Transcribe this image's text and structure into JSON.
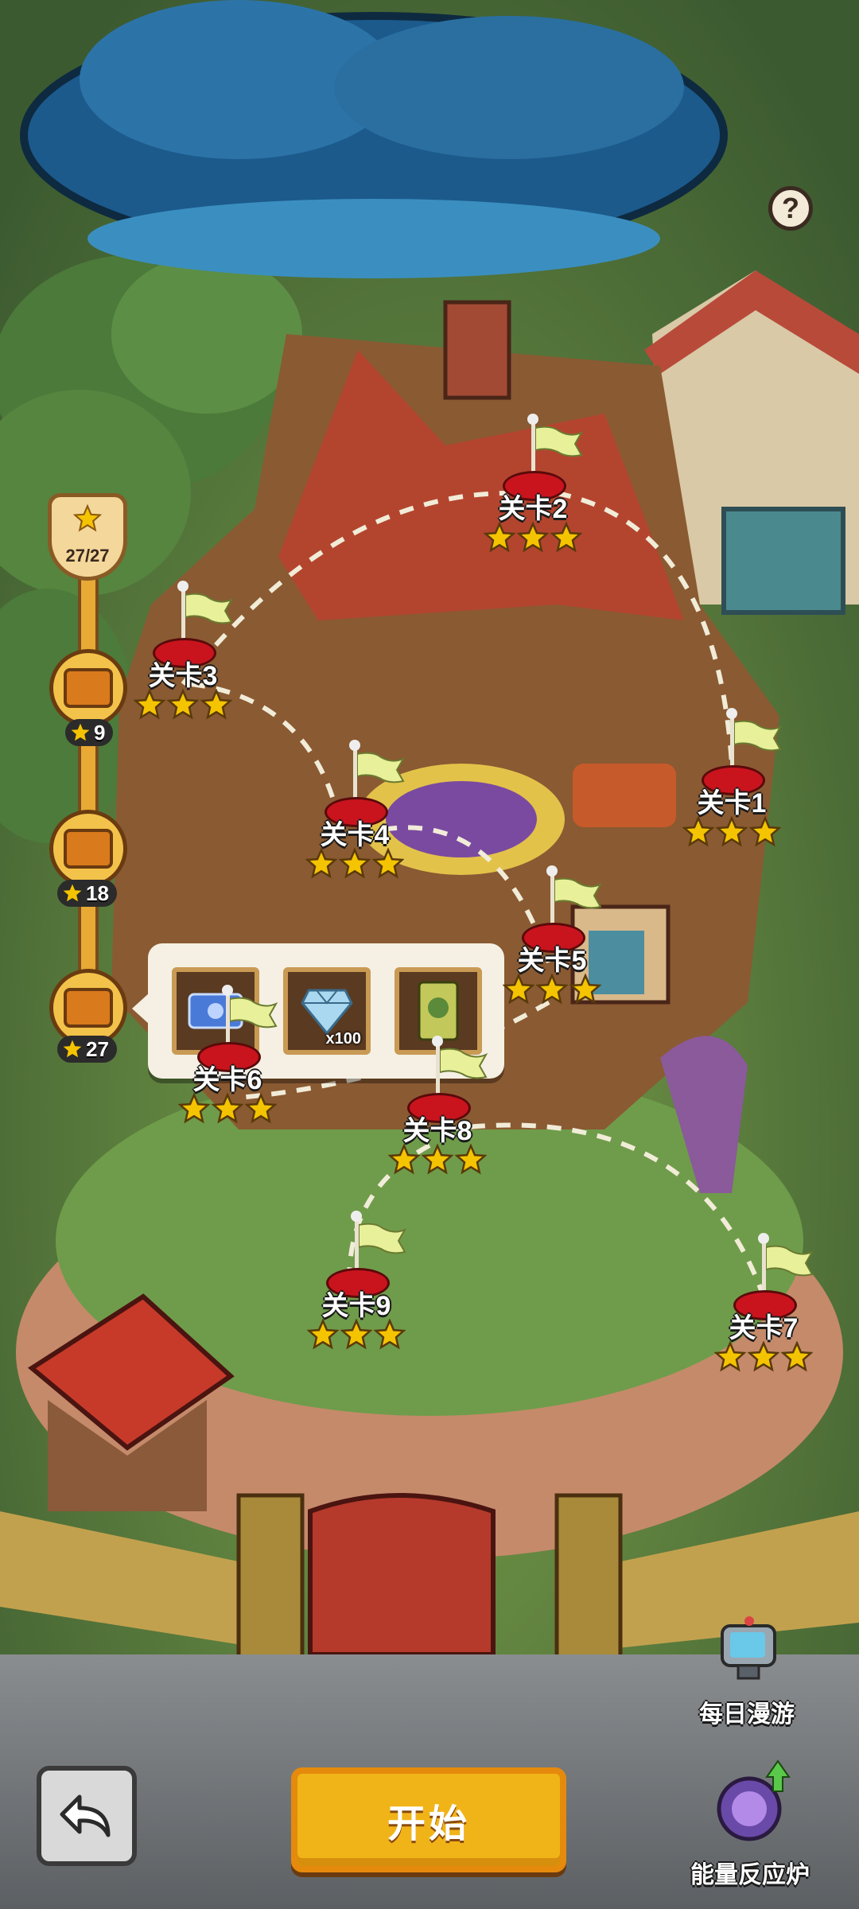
{
  "help": {
    "label": "?"
  },
  "progress": {
    "star_total": "27/27",
    "chests": [
      {
        "required": "9"
      },
      {
        "required": "18"
      },
      {
        "required": "27"
      }
    ]
  },
  "reward_popup": {
    "items": [
      {
        "icon": "ticket-icon",
        "qty": ""
      },
      {
        "icon": "diamond-icon",
        "qty": "x100"
      },
      {
        "icon": "card-icon",
        "qty": ""
      }
    ]
  },
  "levels": [
    {
      "name": "关卡1",
      "stars": 3
    },
    {
      "name": "关卡2",
      "stars": 3
    },
    {
      "name": "关卡3",
      "stars": 3
    },
    {
      "name": "关卡4",
      "stars": 3
    },
    {
      "name": "关卡5",
      "stars": 3
    },
    {
      "name": "关卡6",
      "stars": 3
    },
    {
      "name": "关卡7",
      "stars": 3
    },
    {
      "name": "关卡8",
      "stars": 3
    },
    {
      "name": "关卡9",
      "stars": 3
    }
  ],
  "buttons": {
    "start": "开始",
    "daily_roam": "每日漫游",
    "energy_reactor": "能量反应炉"
  },
  "colors": {
    "star": "#f5c400",
    "flag": "#e8f09a",
    "pad": "#c9141e",
    "accent": "#f1b418"
  }
}
